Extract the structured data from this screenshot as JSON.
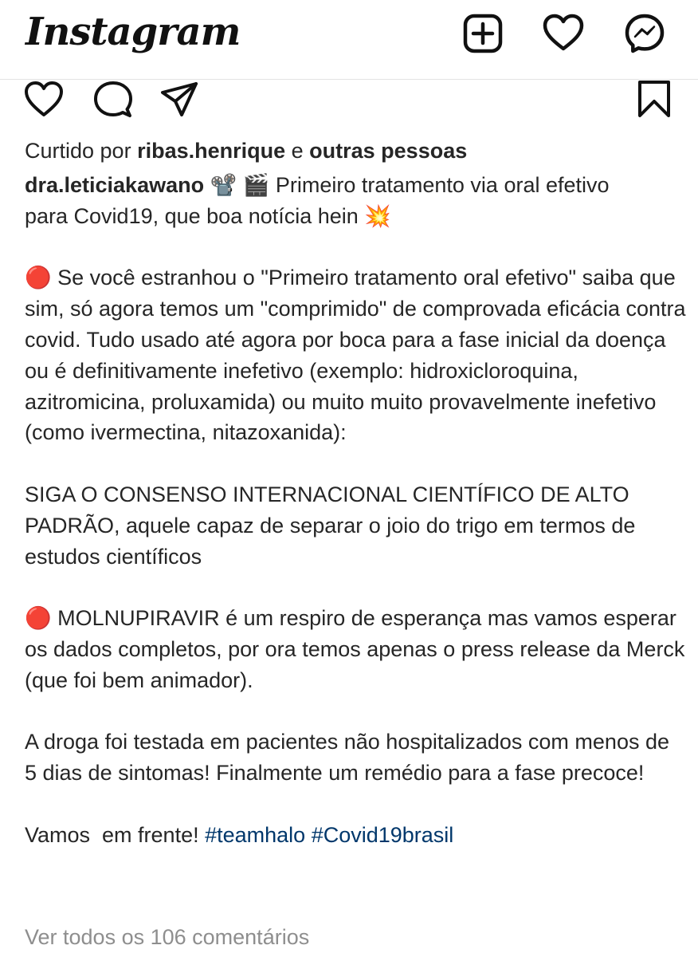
{
  "header": {
    "logo": "Instagram",
    "icons": [
      "new-post-icon",
      "activity-heart-icon",
      "messenger-icon"
    ]
  },
  "post_actions": {
    "icons": [
      "like-heart-icon",
      "comment-icon",
      "share-icon",
      "save-bookmark-icon"
    ]
  },
  "likes": {
    "prefix": "Curtido por ",
    "user": "ribas.henrique",
    "connector": " e ",
    "others": "outras pessoas"
  },
  "caption": {
    "username": "dra.leticiakawano",
    "first_line": " 📽️ 🎬 Primeiro tratamento via oral efetivo",
    "second_line": "para Covid19, que boa notícia hein 💥",
    "para1": "🔴 Se você estranhou o \"Primeiro tratamento oral efetivo\" saiba que sim, só agora temos um \"comprimido\" de comprovada eficácia contra covid. Tudo usado até agora por boca para a fase inicial da doença ou é definitivamente inefetivo (exemplo: hidroxicloroquina, azitromicina, proluxamida) ou muito muito provavelmente inefetivo (como ivermectina, nitazoxanida):",
    "para2": "SIGA O CONSENSO INTERNACIONAL CIENTÍFICO DE ALTO PADRÃO, aquele capaz de separar o joio do trigo em termos de estudos científicos",
    "para3": "🔴 MOLNUPIRAVIR é um respiro de esperança mas vamos esperar os dados completos, por ora temos apenas o press release da Merck (que foi bem animador).",
    "para4": "A droga foi testada em pacientes não hospitalizados com menos de 5 dias de sintomas! Finalmente um remédio para a fase precoce!",
    "closing_text": "Vamos  em frente! ",
    "hashtags": [
      "#teamhalo",
      "#Covid19brasil"
    ]
  },
  "comments_link": "Ver todos os 106 comentários",
  "colors": {
    "text": "#262626",
    "hashtag": "#00376b",
    "muted": "#8e8e8e",
    "divider": "#e3e3e3"
  }
}
